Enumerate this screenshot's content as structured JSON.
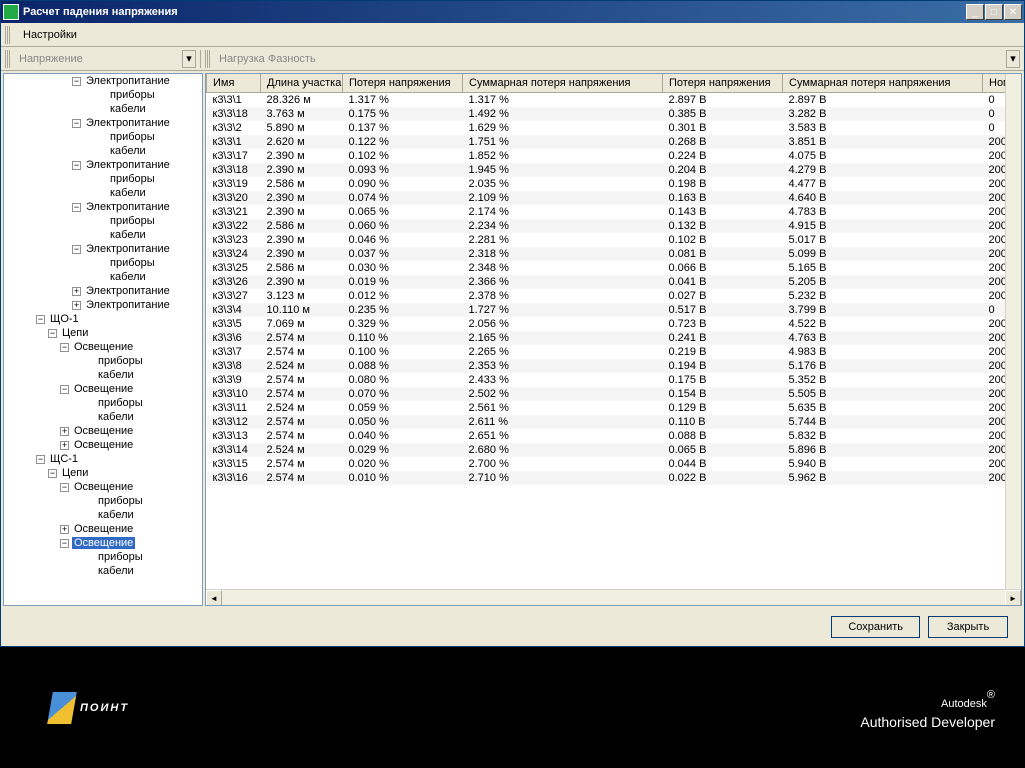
{
  "window": {
    "title": "Расчет падения напряжения"
  },
  "menubar": {
    "settings": "Настройки"
  },
  "toolbar": {
    "voltage": "Напряжение",
    "load_phase": "Нагрузка  Фазность"
  },
  "tree": [
    {
      "indent": 3,
      "exp": "-",
      "label": "Электропитание"
    },
    {
      "indent": 5,
      "exp": "",
      "label": "приборы"
    },
    {
      "indent": 5,
      "exp": "",
      "label": "кабели"
    },
    {
      "indent": 3,
      "exp": "-",
      "label": "Электропитание"
    },
    {
      "indent": 5,
      "exp": "",
      "label": "приборы"
    },
    {
      "indent": 5,
      "exp": "",
      "label": "кабели"
    },
    {
      "indent": 3,
      "exp": "-",
      "label": "Электропитание"
    },
    {
      "indent": 5,
      "exp": "",
      "label": "приборы"
    },
    {
      "indent": 5,
      "exp": "",
      "label": "кабели"
    },
    {
      "indent": 3,
      "exp": "-",
      "label": "Электропитание"
    },
    {
      "indent": 5,
      "exp": "",
      "label": "приборы"
    },
    {
      "indent": 5,
      "exp": "",
      "label": "кабели"
    },
    {
      "indent": 3,
      "exp": "-",
      "label": "Электропитание"
    },
    {
      "indent": 5,
      "exp": "",
      "label": "приборы"
    },
    {
      "indent": 5,
      "exp": "",
      "label": "кабели"
    },
    {
      "indent": 3,
      "exp": "+",
      "label": "Электропитание"
    },
    {
      "indent": 3,
      "exp": "+",
      "label": "Электропитание"
    },
    {
      "indent": 0,
      "exp": "-",
      "label": "ЩО-1"
    },
    {
      "indent": 1,
      "exp": "-",
      "label": "Цепи"
    },
    {
      "indent": 2,
      "exp": "-",
      "label": "Освещение"
    },
    {
      "indent": 4,
      "exp": "",
      "label": "приборы"
    },
    {
      "indent": 4,
      "exp": "",
      "label": "кабели"
    },
    {
      "indent": 2,
      "exp": "-",
      "label": "Освещение"
    },
    {
      "indent": 4,
      "exp": "",
      "label": "приборы"
    },
    {
      "indent": 4,
      "exp": "",
      "label": "кабели"
    },
    {
      "indent": 2,
      "exp": "+",
      "label": "Освещение"
    },
    {
      "indent": 2,
      "exp": "+",
      "label": "Освещение"
    },
    {
      "indent": 0,
      "exp": "-",
      "label": "ЩС-1"
    },
    {
      "indent": 1,
      "exp": "-",
      "label": "Цепи"
    },
    {
      "indent": 2,
      "exp": "-",
      "label": "Освещение"
    },
    {
      "indent": 4,
      "exp": "",
      "label": "приборы"
    },
    {
      "indent": 4,
      "exp": "",
      "label": "кабели"
    },
    {
      "indent": 2,
      "exp": "+",
      "label": "Освещение"
    },
    {
      "indent": 2,
      "exp": "-",
      "label": "Освещение",
      "selected": true
    },
    {
      "indent": 4,
      "exp": "",
      "label": "приборы"
    },
    {
      "indent": 4,
      "exp": "",
      "label": "кабели"
    }
  ],
  "table": {
    "headers": {
      "name": "Имя",
      "length": "Длина участка",
      "loss_pct": "Потеря напряжения",
      "sum_pct": "Суммарная потеря напряжения",
      "loss_v": "Потеря напряжения",
      "sum_v": "Суммарная потеря напряжения",
      "nominal": "Номинал"
    },
    "rows": [
      {
        "name": "к3\\3\\1",
        "len": "28.326 м",
        "loss_pct": "1.317 %",
        "sum_pct": "1.317 %",
        "loss_v": "2.897 В",
        "sum_v": "2.897 В",
        "nom": "0"
      },
      {
        "name": "к3\\3\\18",
        "len": "3.763 м",
        "loss_pct": "0.175 %",
        "sum_pct": "1.492 %",
        "loss_v": "0.385 В",
        "sum_v": "3.282 В",
        "nom": "0"
      },
      {
        "name": "к3\\3\\2",
        "len": "5.890 м",
        "loss_pct": "0.137 %",
        "sum_pct": "1.629 %",
        "loss_v": "0.301 В",
        "sum_v": "3.583 В",
        "nom": "0"
      },
      {
        "name": "к3\\3\\1",
        "len": "2.620 м",
        "loss_pct": "0.122 %",
        "sum_pct": "1.751 %",
        "loss_v": "0.268 В",
        "sum_v": "3.851 В",
        "nom": "200"
      },
      {
        "name": "к3\\3\\17",
        "len": "2.390 м",
        "loss_pct": "0.102 %",
        "sum_pct": "1.852 %",
        "loss_v": "0.224 В",
        "sum_v": "4.075 В",
        "nom": "200"
      },
      {
        "name": "к3\\3\\18",
        "len": "2.390 м",
        "loss_pct": "0.093 %",
        "sum_pct": "1.945 %",
        "loss_v": "0.204 В",
        "sum_v": "4.279 В",
        "nom": "200"
      },
      {
        "name": "к3\\3\\19",
        "len": "2.586 м",
        "loss_pct": "0.090 %",
        "sum_pct": "2.035 %",
        "loss_v": "0.198 В",
        "sum_v": "4.477 В",
        "nom": "200"
      },
      {
        "name": "к3\\3\\20",
        "len": "2.390 м",
        "loss_pct": "0.074 %",
        "sum_pct": "2.109 %",
        "loss_v": "0.163 В",
        "sum_v": "4.640 В",
        "nom": "200"
      },
      {
        "name": "к3\\3\\21",
        "len": "2.390 м",
        "loss_pct": "0.065 %",
        "sum_pct": "2.174 %",
        "loss_v": "0.143 В",
        "sum_v": "4.783 В",
        "nom": "200"
      },
      {
        "name": "к3\\3\\22",
        "len": "2.586 м",
        "loss_pct": "0.060 %",
        "sum_pct": "2.234 %",
        "loss_v": "0.132 В",
        "sum_v": "4.915 В",
        "nom": "200"
      },
      {
        "name": "к3\\3\\23",
        "len": "2.390 м",
        "loss_pct": "0.046 %",
        "sum_pct": "2.281 %",
        "loss_v": "0.102 В",
        "sum_v": "5.017 В",
        "nom": "200"
      },
      {
        "name": "к3\\3\\24",
        "len": "2.390 м",
        "loss_pct": "0.037 %",
        "sum_pct": "2.318 %",
        "loss_v": "0.081 В",
        "sum_v": "5.099 В",
        "nom": "200"
      },
      {
        "name": "к3\\3\\25",
        "len": "2.586 м",
        "loss_pct": "0.030 %",
        "sum_pct": "2.348 %",
        "loss_v": "0.066 В",
        "sum_v": "5.165 В",
        "nom": "200"
      },
      {
        "name": "к3\\3\\26",
        "len": "2.390 м",
        "loss_pct": "0.019 %",
        "sum_pct": "2.366 %",
        "loss_v": "0.041 В",
        "sum_v": "5.205 В",
        "nom": "200"
      },
      {
        "name": "к3\\3\\27",
        "len": "3.123 м",
        "loss_pct": "0.012 %",
        "sum_pct": "2.378 %",
        "loss_v": "0.027 В",
        "sum_v": "5.232 В",
        "nom": "200"
      },
      {
        "name": "к3\\3\\4",
        "len": "10.110 м",
        "loss_pct": "0.235 %",
        "sum_pct": "1.727 %",
        "loss_v": "0.517 В",
        "sum_v": "3.799 В",
        "nom": "0"
      },
      {
        "name": "к3\\3\\5",
        "len": "7.069 м",
        "loss_pct": "0.329 %",
        "sum_pct": "2.056 %",
        "loss_v": "0.723 В",
        "sum_v": "4.522 В",
        "nom": "200"
      },
      {
        "name": "к3\\3\\6",
        "len": "2.574 м",
        "loss_pct": "0.110 %",
        "sum_pct": "2.165 %",
        "loss_v": "0.241 В",
        "sum_v": "4.763 В",
        "nom": "200"
      },
      {
        "name": "к3\\3\\7",
        "len": "2.574 м",
        "loss_pct": "0.100 %",
        "sum_pct": "2.265 %",
        "loss_v": "0.219 В",
        "sum_v": "4.983 В",
        "nom": "200"
      },
      {
        "name": "к3\\3\\8",
        "len": "2.524 м",
        "loss_pct": "0.088 %",
        "sum_pct": "2.353 %",
        "loss_v": "0.194 В",
        "sum_v": "5.176 В",
        "nom": "200"
      },
      {
        "name": "к3\\3\\9",
        "len": "2.574 м",
        "loss_pct": "0.080 %",
        "sum_pct": "2.433 %",
        "loss_v": "0.175 В",
        "sum_v": "5.352 В",
        "nom": "200"
      },
      {
        "name": "к3\\3\\10",
        "len": "2.574 м",
        "loss_pct": "0.070 %",
        "sum_pct": "2.502 %",
        "loss_v": "0.154 В",
        "sum_v": "5.505 В",
        "nom": "200"
      },
      {
        "name": "к3\\3\\11",
        "len": "2.524 м",
        "loss_pct": "0.059 %",
        "sum_pct": "2.561 %",
        "loss_v": "0.129 В",
        "sum_v": "5.635 В",
        "nom": "200"
      },
      {
        "name": "к3\\3\\12",
        "len": "2.574 м",
        "loss_pct": "0.050 %",
        "sum_pct": "2.611 %",
        "loss_v": "0.110 В",
        "sum_v": "5.744 В",
        "nom": "200"
      },
      {
        "name": "к3\\3\\13",
        "len": "2.574 м",
        "loss_pct": "0.040 %",
        "sum_pct": "2.651 %",
        "loss_v": "0.088 В",
        "sum_v": "5.832 В",
        "nom": "200"
      },
      {
        "name": "к3\\3\\14",
        "len": "2.524 м",
        "loss_pct": "0.029 %",
        "sum_pct": "2.680 %",
        "loss_v": "0.065 В",
        "sum_v": "5.896 В",
        "nom": "200"
      },
      {
        "name": "к3\\3\\15",
        "len": "2.574 м",
        "loss_pct": "0.020 %",
        "sum_pct": "2.700 %",
        "loss_v": "0.044 В",
        "sum_v": "5.940 В",
        "nom": "200"
      },
      {
        "name": "к3\\3\\16",
        "len": "2.574 м",
        "loss_pct": "0.010 %",
        "sum_pct": "2.710 %",
        "loss_v": "0.022 В",
        "sum_v": "5.962 В",
        "nom": "200"
      }
    ]
  },
  "buttons": {
    "save": "Сохранить",
    "close": "Закрыть"
  },
  "footer": {
    "point_text": "ПОИНТ",
    "autodesk": "Autodesk",
    "autodesk_sub": "Authorised Developer"
  }
}
